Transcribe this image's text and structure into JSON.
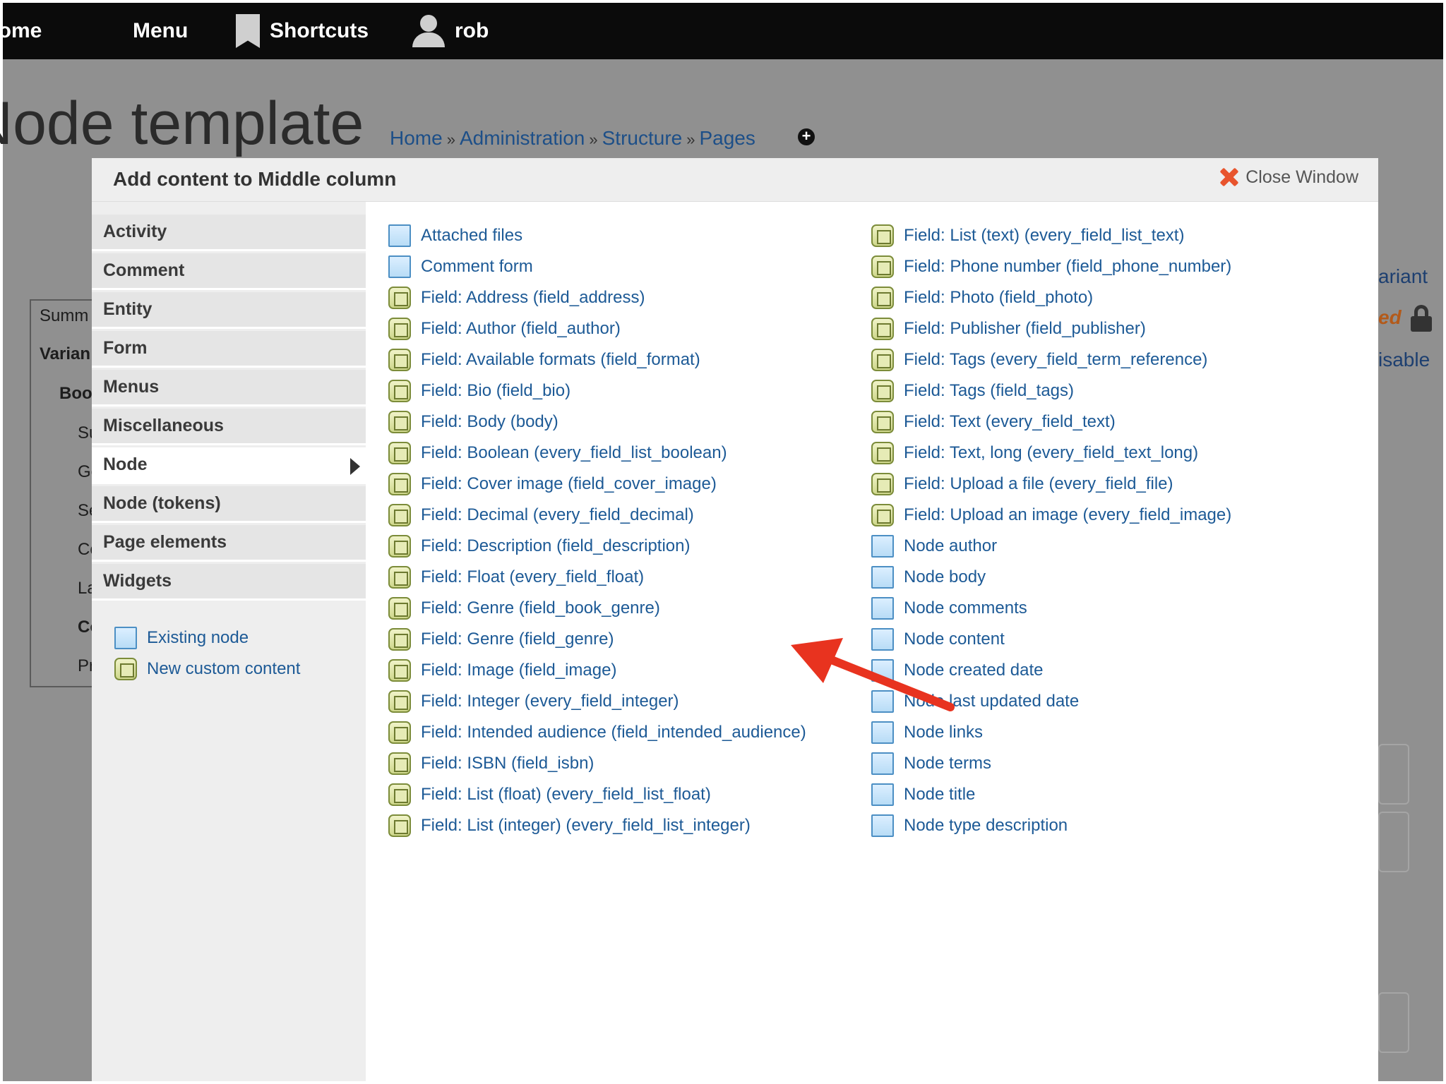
{
  "toolbar": {
    "home_label": "Home",
    "menu_label": "Menu",
    "shortcuts_label": "Shortcuts",
    "user_label": "rob"
  },
  "page": {
    "title": "Node template",
    "breadcrumb": [
      "Home",
      "Administration",
      "Structure",
      "Pages"
    ],
    "breadcrumb_separator": "»",
    "left_panel": {
      "items": [
        "Summ",
        "Varian",
        "Boo",
        "Su",
        "Ge",
        "Se",
        "Co",
        "La",
        "Co",
        "Pr"
      ]
    },
    "right_panel": {
      "items": [
        "ariant",
        "ed",
        "isable"
      ]
    }
  },
  "modal": {
    "title": "Add content to Middle column",
    "close_label": "Close Window",
    "categories": [
      "Activity",
      "Comment",
      "Entity",
      "Form",
      "Menus",
      "Miscellaneous",
      "Node",
      "Node (tokens)",
      "Page elements",
      "Widgets"
    ],
    "active_category": "Node",
    "sidebar_links": [
      {
        "label": "Existing node",
        "icon": "doc-icon"
      },
      {
        "label": "New custom content",
        "icon": "box-icon"
      }
    ],
    "column_1": [
      {
        "label": "Attached files",
        "icon": "doc-icon"
      },
      {
        "label": "Comment form",
        "icon": "doc-icon"
      },
      {
        "label": "Field: Address (field_address)",
        "icon": "box-icon"
      },
      {
        "label": "Field: Author (field_author)",
        "icon": "box-icon"
      },
      {
        "label": "Field: Available formats (field_format)",
        "icon": "box-icon"
      },
      {
        "label": "Field: Bio (field_bio)",
        "icon": "box-icon"
      },
      {
        "label": "Field: Body (body)",
        "icon": "box-icon"
      },
      {
        "label": "Field: Boolean (every_field_list_boolean)",
        "icon": "box-icon"
      },
      {
        "label": "Field: Cover image (field_cover_image)",
        "icon": "box-icon"
      },
      {
        "label": "Field: Decimal (every_field_decimal)",
        "icon": "box-icon"
      },
      {
        "label": "Field: Description (field_description)",
        "icon": "box-icon"
      },
      {
        "label": "Field: Float (every_field_float)",
        "icon": "box-icon"
      },
      {
        "label": "Field: Genre (field_book_genre)",
        "icon": "box-icon"
      },
      {
        "label": "Field: Genre (field_genre)",
        "icon": "box-icon"
      },
      {
        "label": "Field: Image (field_image)",
        "icon": "box-icon"
      },
      {
        "label": "Field: Integer (every_field_integer)",
        "icon": "box-icon"
      },
      {
        "label": "Field: Intended audience (field_intended_audience)",
        "icon": "box-icon"
      },
      {
        "label": "Field: ISBN (field_isbn)",
        "icon": "box-icon"
      },
      {
        "label": "Field: List (float) (every_field_list_float)",
        "icon": "box-icon"
      },
      {
        "label": "Field: List (integer) (every_field_list_integer)",
        "icon": "box-icon"
      }
    ],
    "column_2": [
      {
        "label": "Field: List (text) (every_field_list_text)",
        "icon": "box-icon"
      },
      {
        "label": "Field: Phone number (field_phone_number)",
        "icon": "box-icon"
      },
      {
        "label": "Field: Photo (field_photo)",
        "icon": "box-icon"
      },
      {
        "label": "Field: Publisher (field_publisher)",
        "icon": "box-icon"
      },
      {
        "label": "Field: Tags (every_field_term_reference)",
        "icon": "box-icon"
      },
      {
        "label": "Field: Tags (field_tags)",
        "icon": "box-icon"
      },
      {
        "label": "Field: Text (every_field_text)",
        "icon": "box-icon"
      },
      {
        "label": "Field: Text, long (every_field_text_long)",
        "icon": "box-icon"
      },
      {
        "label": "Field: Upload a file (every_field_file)",
        "icon": "box-icon"
      },
      {
        "label": "Field: Upload an image (every_field_image)",
        "icon": "box-icon"
      },
      {
        "label": "Node author",
        "icon": "doc-icon"
      },
      {
        "label": "Node body",
        "icon": "doc-icon"
      },
      {
        "label": "Node comments",
        "icon": "doc-icon"
      },
      {
        "label": "Node content",
        "icon": "doc-icon"
      },
      {
        "label": "Node created date",
        "icon": "doc-icon"
      },
      {
        "label": "Node last updated date",
        "icon": "doc-icon"
      },
      {
        "label": "Node links",
        "icon": "doc-icon"
      },
      {
        "label": "Node terms",
        "icon": "doc-icon"
      },
      {
        "label": "Node title",
        "icon": "doc-icon"
      },
      {
        "label": "Node type description",
        "icon": "doc-icon"
      }
    ]
  },
  "annotation": {
    "arrow_color": "#e8331f",
    "points_to": "Field: Cover image (field_cover_image)"
  },
  "colors": {
    "toolbar_bg": "#0b0b0b",
    "overlay_bg": "#909090",
    "link": "#1d5a96",
    "close_icon": "#e8542d"
  }
}
